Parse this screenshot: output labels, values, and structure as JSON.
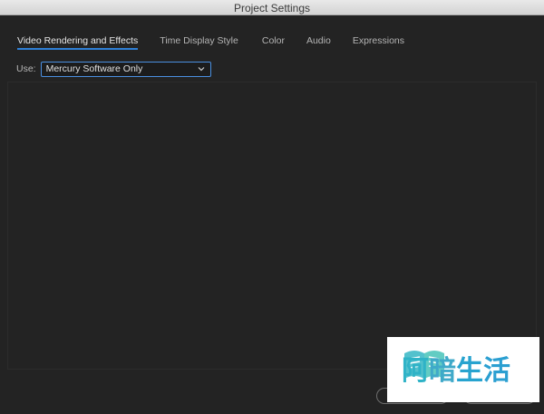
{
  "window": {
    "title": "Project Settings"
  },
  "tabs": [
    {
      "label": "Video Rendering and Effects",
      "active": true
    },
    {
      "label": "Time Display Style",
      "active": false
    },
    {
      "label": "Color",
      "active": false
    },
    {
      "label": "Audio",
      "active": false
    },
    {
      "label": "Expressions",
      "active": false
    }
  ],
  "renderer": {
    "label": "Use:",
    "selected": "Mercury Software Only"
  },
  "watermark": {
    "chars": [
      "阿",
      "暗",
      "生",
      "活"
    ]
  },
  "colors": {
    "accent": "#2f80d6",
    "background": "#232323",
    "watermark": "#2fb3c7"
  }
}
